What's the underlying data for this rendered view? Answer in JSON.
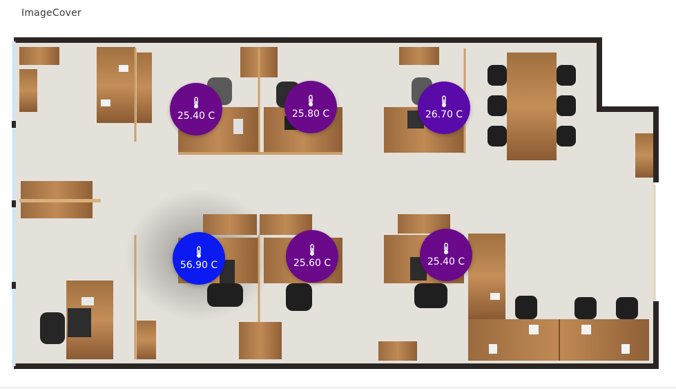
{
  "card": {
    "title": "ImageCover"
  },
  "markers": [
    {
      "value": "25.40 C",
      "color": "#6a0a8a",
      "icon": "thermometer-icon"
    },
    {
      "value": "25.80 C",
      "color": "#6a0a8a",
      "icon": "thermometer-icon"
    },
    {
      "value": "26.70 C",
      "color": "#5a0aa8",
      "icon": "thermometer-icon"
    },
    {
      "value": "56.90 C",
      "color": "#0a1af0",
      "icon": "thermometer-icon"
    },
    {
      "value": "25.60 C",
      "color": "#6a0a8a",
      "icon": "thermometer-icon"
    },
    {
      "value": "25.40 C",
      "color": "#6a0a8a",
      "icon": "thermometer-icon"
    }
  ]
}
